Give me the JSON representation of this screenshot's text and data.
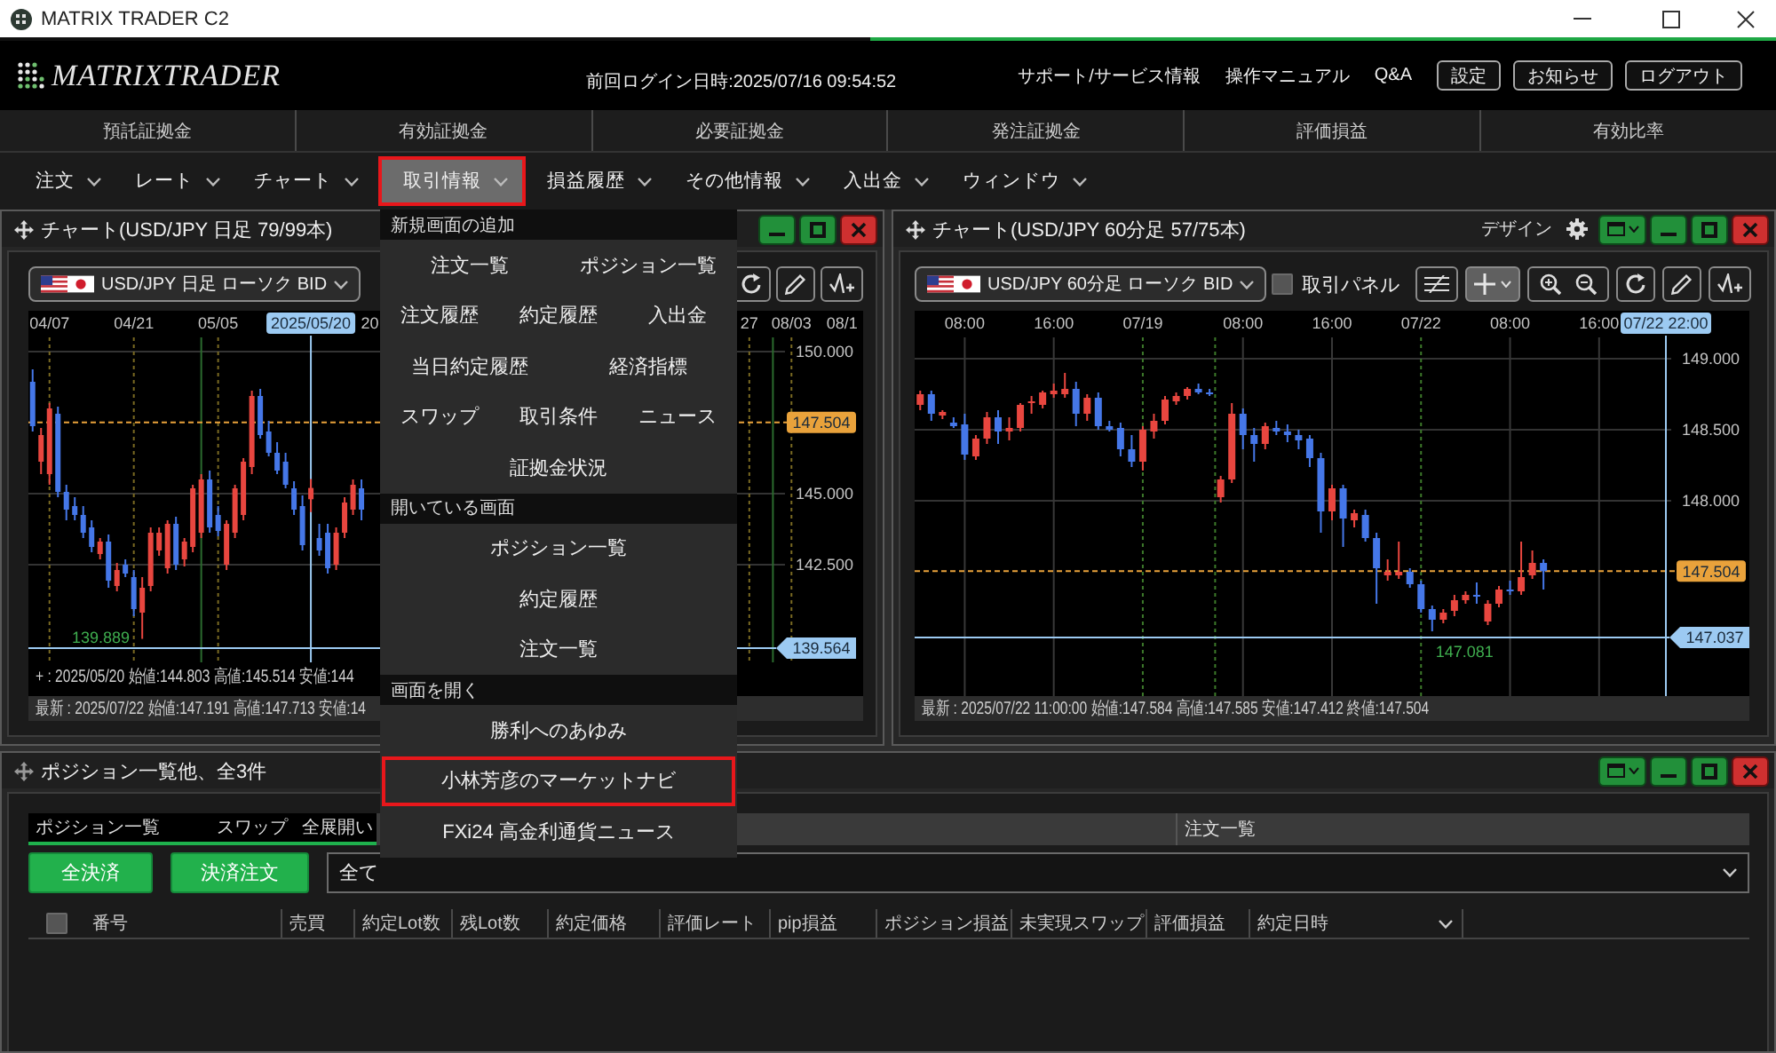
{
  "window": {
    "title": "MATRIX TRADER C2"
  },
  "header": {
    "logo": "MATRIXTRADER",
    "last_login": "前回ログイン日時:2025/07/16 09:54:52",
    "links": [
      "サポート/サービス情報",
      "操作マニュアル",
      "Q&A"
    ],
    "buttons": [
      "設定",
      "お知らせ",
      "ログアウト"
    ]
  },
  "summary": [
    "預託証拠金",
    "有効証拠金",
    "必要証拠金",
    "発注証拠金",
    "評価損益",
    "有効比率"
  ],
  "menu": [
    {
      "label": "注文",
      "selected": false,
      "highlighted": false
    },
    {
      "label": "レート",
      "selected": false,
      "highlighted": false
    },
    {
      "label": "チャート",
      "selected": false,
      "highlighted": false
    },
    {
      "label": "取引情報",
      "selected": true,
      "highlighted": true
    },
    {
      "label": "損益履歴",
      "selected": false,
      "highlighted": false
    },
    {
      "label": "その他情報",
      "selected": false,
      "highlighted": false
    },
    {
      "label": "入出金",
      "selected": false,
      "highlighted": false
    },
    {
      "label": "ウィンドウ",
      "selected": false,
      "highlighted": false
    }
  ],
  "dropdown": {
    "sections": [
      {
        "title": "新規画面の追加",
        "rows": [
          {
            "items": [
              {
                "label": "注文一覧",
                "highlighted": false
              },
              {
                "label": "ポジション一覧",
                "highlighted": false
              }
            ]
          },
          {
            "items": [
              {
                "label": "注文履歴",
                "highlighted": false
              },
              {
                "label": "約定履歴",
                "highlighted": false
              },
              {
                "label": "入出金",
                "highlighted": false
              }
            ]
          },
          {
            "items": [
              {
                "label": "当日約定履歴",
                "highlighted": false
              },
              {
                "label": "経済指標",
                "highlighted": false
              }
            ]
          },
          {
            "items": [
              {
                "label": "スワップ",
                "highlighted": false
              },
              {
                "label": "取引条件",
                "highlighted": false
              },
              {
                "label": "ニュース",
                "highlighted": false
              }
            ]
          },
          {
            "items": [
              {
                "label": "証拠金状況",
                "highlighted": false
              }
            ]
          }
        ]
      },
      {
        "title": "開いている画面",
        "rows": [
          {
            "items": [
              {
                "label": "ポジション一覧",
                "highlighted": false
              }
            ]
          },
          {
            "items": [
              {
                "label": "約定履歴",
                "highlighted": false
              }
            ]
          },
          {
            "items": [
              {
                "label": "注文一覧",
                "highlighted": false
              }
            ]
          }
        ]
      },
      {
        "title": "画面を開く",
        "rows": [
          {
            "items": [
              {
                "label": "勝利へのあゆみ",
                "highlighted": false
              }
            ]
          },
          {
            "items": [
              {
                "label": "小林芳彦のマーケットナビ",
                "highlighted": true
              }
            ]
          },
          {
            "items": [
              {
                "label": "FXi24 高金利通貨ニュース",
                "highlighted": false
              }
            ]
          }
        ]
      }
    ]
  },
  "charts": [
    {
      "title": "チャート(USD/JPY 日足 79/99本)",
      "window_controls": [
        {
          "kind": "minimize"
        },
        {
          "kind": "maximize"
        },
        {
          "kind": "close"
        }
      ],
      "symbol": "USD/JPY 日足 ローソク BID",
      "tools": [
        {
          "kind": "refresh",
          "selected": false
        },
        {
          "kind": "pencil",
          "selected": false
        },
        {
          "kind": "wave",
          "selected": false
        }
      ],
      "chart_data": {
        "type": "candlestick",
        "categories": [
          null,
          null,
          "04/07",
          null,
          null,
          null,
          null,
          null,
          null,
          null,
          null,
          null,
          "04/21",
          null,
          null,
          null,
          null,
          null,
          null,
          null,
          null,
          null,
          "05/05",
          null,
          null,
          null,
          null,
          null,
          null,
          null,
          null,
          null,
          null,
          "2025/05/20",
          null,
          null,
          null,
          null,
          null,
          null,
          "20",
          null,
          null,
          null,
          null,
          null,
          null,
          null,
          null,
          null,
          null,
          null,
          null,
          null,
          null,
          null,
          null,
          null,
          null,
          null,
          null,
          null,
          null,
          null,
          null,
          null,
          null,
          null,
          null,
          null,
          null,
          null,
          null,
          null,
          null,
          null,
          null,
          null,
          null,
          null,
          null,
          null,
          null,
          null,
          null,
          "27",
          null,
          null,
          null,
          null,
          "08/03",
          null,
          null,
          null,
          null,
          null,
          "08/1",
          null,
          null
        ],
        "ohlc": [
          [
            148.9375,
            149.375,
            147.1875,
            147.375
          ],
          [
            146.125,
            147.3125,
            145.6875,
            147.0625
          ],
          [
            145.6875,
            148.1875,
            145.3125,
            148.0
          ],
          [
            147.8125,
            148.0625,
            144.875,
            145.0625
          ],
          [
            145.0625,
            145.3125,
            144.0625,
            144.4375
          ],
          [
            144.5625,
            144.875,
            144.0625,
            144.25
          ],
          [
            144.25,
            144.5625,
            143.4375,
            143.625
          ],
          [
            143.8125,
            144.0625,
            142.9375,
            143.125
          ],
          [
            142.875,
            143.4375,
            142.6875,
            143.3125
          ],
          [
            143.3125,
            143.5625,
            141.6875,
            141.9375
          ],
          [
            141.75,
            142.5625,
            141.5625,
            142.3125
          ],
          [
            142.5,
            142.6875,
            142.0625,
            142.1875
          ],
          [
            142.0625,
            142.3125,
            140.6875,
            140.9375
          ],
          [
            140.8125,
            142.0625,
            139.889,
            141.6875
          ],
          [
            141.75,
            143.8125,
            141.5625,
            143.625
          ],
          [
            143.0,
            143.8125,
            142.8125,
            143.625
          ],
          [
            142.375,
            144.0625,
            142.1875,
            143.9375
          ],
          [
            143.9375,
            144.1875,
            142.3125,
            142.5
          ],
          [
            142.6875,
            143.4375,
            142.4375,
            143.3125
          ],
          [
            143.125,
            145.3125,
            142.9375,
            145.1875
          ],
          [
            143.625,
            145.6875,
            143.4375,
            145.5
          ],
          [
            145.5,
            145.8125,
            143.625,
            143.8125
          ],
          [
            144.25,
            144.5625,
            143.5,
            143.6875
          ],
          [
            142.5,
            144.0625,
            142.3125,
            143.9375
          ],
          [
            143.625,
            145.3125,
            143.4375,
            145.1875
          ],
          [
            144.25,
            146.25,
            144.0625,
            146.125
          ],
          [
            145.9375,
            148.625,
            145.6875,
            148.4375
          ],
          [
            148.4375,
            148.6875,
            146.9375,
            147.0625
          ],
          [
            147.1875,
            147.5625,
            146.3125,
            146.4375
          ],
          [
            146.4375,
            146.8125,
            145.6875,
            145.8125
          ],
          [
            146.125,
            146.4375,
            145.1875,
            145.3125
          ],
          [
            145.1875,
            145.4375,
            144.25,
            144.4375
          ],
          [
            144.5625,
            144.9375,
            143.0,
            143.1875
          ],
          [
            144.803,
            145.514,
            144.35,
            145.2
          ],
          [
            143.4375,
            143.9375,
            142.8125,
            143.0
          ],
          [
            143.625,
            143.9375,
            142.1875,
            142.375
          ],
          [
            142.5,
            143.8125,
            142.3125,
            143.625
          ],
          [
            143.625,
            144.875,
            143.4375,
            144.6875
          ],
          [
            144.4375,
            145.5,
            144.25,
            145.3125
          ],
          [
            145.1875,
            145.5,
            144.0625,
            144.4375
          ],
          null,
          null,
          null,
          null,
          null,
          null,
          null,
          null,
          null,
          null,
          null,
          null,
          null,
          null,
          null,
          null,
          null,
          null,
          null,
          null,
          null,
          null,
          null,
          null,
          null,
          null,
          null,
          null,
          null,
          null,
          null,
          null,
          null,
          null,
          null,
          null,
          null,
          null,
          null,
          null,
          null,
          null,
          null,
          null,
          null,
          null,
          null,
          null,
          null,
          null,
          null,
          null,
          null,
          null,
          null,
          null,
          null,
          null,
          null
        ],
        "ylim": [
          137.875,
          151.4375
        ],
        "yticks": [
          {
            "value": 150,
            "label": "150.000"
          },
          {
            "value": 145,
            "label": "145.000"
          },
          {
            "value": 142.5,
            "label": "142.500"
          }
        ],
        "grid": true,
        "ref_lines": [
          {
            "axis": "y",
            "value": 147.504,
            "label": "147.504",
            "color": "#e9a23b"
          },
          {
            "axis": "y",
            "value": 139.564,
            "label": "139.564",
            "color": "#9ccaf2"
          },
          {
            "axis": "x",
            "value": "2025/05/20",
            "color": "#9ccaf2"
          }
        ],
        "annotations": [
          "139.889"
        ]
      },
      "cursor_info": "+ : 2025/05/20 始値:144.803 高値:145.514 安値:144",
      "status": "最新 : 2025/07/22 始値:147.191 高値:147.713 安値:14"
    },
    {
      "title": "チャート(USD/JPY 60分足 57/75本)",
      "design_label": "デザイン",
      "window_controls": [
        {
          "kind": "layout"
        },
        {
          "kind": "minimize"
        },
        {
          "kind": "maximize"
        },
        {
          "kind": "close"
        }
      ],
      "symbol": "USD/JPY 60分足 ローソク BID",
      "trade_panel": {
        "label": "取引パネル",
        "checked": false
      },
      "tools": [
        {
          "kind": "indicator",
          "selected": false
        },
        {
          "kind": "crosshair",
          "selected": true
        },
        {
          "kind": "zoom",
          "selected": false
        },
        {
          "kind": "refresh",
          "selected": false
        },
        {
          "kind": "pencil",
          "selected": false
        },
        {
          "kind": "wave",
          "selected": false
        }
      ],
      "chart_data": {
        "type": "candlestick",
        "categories": [
          null,
          null,
          null,
          null,
          "08:00",
          null,
          null,
          null,
          null,
          null,
          null,
          null,
          "16:00",
          null,
          null,
          null,
          null,
          null,
          null,
          null,
          "07/19",
          null,
          null,
          null,
          null,
          null,
          null,
          null,
          null,
          "08:00",
          null,
          null,
          null,
          null,
          null,
          null,
          null,
          "16:00",
          null,
          null,
          null,
          null,
          null,
          null,
          null,
          "07/22",
          null,
          null,
          null,
          null,
          null,
          null,
          null,
          "08:00",
          null,
          null,
          null,
          null,
          null,
          null,
          null,
          "16:00",
          null,
          null,
          null,
          null,
          null,
          "07/22 22:00",
          null,
          null,
          null,
          null,
          null,
          null,
          null
        ],
        "ohlc": [
          [
            148.675,
            148.775,
            148.6375,
            148.75
          ],
          [
            148.75,
            148.775,
            148.5625,
            148.6125
          ],
          [
            148.6,
            148.6375,
            148.575,
            148.625
          ],
          [
            148.55,
            148.5875,
            148.5125,
            148.525
          ],
          [
            148.5375,
            148.6125,
            148.2875,
            148.325
          ],
          [
            148.3125,
            148.4625,
            148.2875,
            148.4375
          ],
          [
            148.4375,
            148.625,
            148.4,
            148.5875
          ],
          [
            148.5875,
            148.6375,
            148.4,
            148.4875
          ],
          [
            148.4875,
            148.5875,
            148.425,
            148.5125
          ],
          [
            148.5125,
            148.6875,
            148.4875,
            148.675
          ],
          [
            148.6875,
            148.7375,
            148.6125,
            148.7
          ],
          [
            148.675,
            148.775,
            148.65,
            148.7625
          ],
          [
            148.75,
            148.825,
            148.725,
            148.775
          ],
          [
            148.75,
            148.9,
            148.725,
            148.7875
          ],
          [
            148.7875,
            148.8375,
            148.525,
            148.6125
          ],
          [
            148.6125,
            148.75,
            148.5625,
            148.725
          ],
          [
            148.725,
            148.7625,
            148.5,
            148.525
          ],
          [
            148.525,
            148.5625,
            148.4875,
            148.5
          ],
          [
            148.5125,
            148.55,
            148.3125,
            148.3625
          ],
          [
            148.3625,
            148.4625,
            148.2375,
            148.275
          ],
          [
            148.275,
            148.525,
            148.2125,
            148.5
          ],
          [
            148.4875,
            148.6125,
            148.4375,
            148.5625
          ],
          [
            148.5625,
            148.7375,
            148.5375,
            148.7125
          ],
          [
            148.7,
            148.7625,
            148.675,
            148.7375
          ],
          [
            148.7375,
            148.8,
            148.7125,
            148.7875
          ],
          [
            148.7875,
            148.825,
            148.75,
            148.7625
          ],
          [
            148.7625,
            148.7875,
            148.7375,
            148.75
          ],
          [
            148.025,
            148.175,
            147.9875,
            148.15
          ],
          [
            148.15,
            148.6875,
            148.125,
            148.6125
          ],
          [
            148.6125,
            148.65,
            148.3625,
            148.4625
          ],
          [
            148.4625,
            148.5125,
            148.275,
            148.4
          ],
          [
            148.4,
            148.55,
            148.3625,
            148.525
          ],
          [
            148.5125,
            148.5625,
            148.4625,
            148.4875
          ],
          [
            148.4875,
            148.5375,
            148.4125,
            148.4625
          ],
          [
            148.4625,
            148.5,
            148.3625,
            148.425
          ],
          [
            148.4375,
            148.4625,
            148.2375,
            148.3
          ],
          [
            148.3,
            148.3375,
            147.775,
            147.925
          ],
          [
            147.925,
            148.1125,
            147.8625,
            148.0875
          ],
          [
            148.0875,
            148.1125,
            147.675,
            147.875
          ],
          [
            147.8625,
            147.9375,
            147.8125,
            147.9125
          ],
          [
            147.9,
            147.9375,
            147.7125,
            147.7375
          ],
          [
            147.7375,
            147.775,
            147.275,
            147.525
          ],
          [
            147.475,
            147.5875,
            147.4375,
            147.5
          ],
          [
            147.475,
            147.7125,
            147.45,
            147.5
          ],
          [
            147.5,
            147.525,
            147.3875,
            147.4125
          ],
          [
            147.4125,
            147.4375,
            147.2125,
            147.2375
          ],
          [
            147.2375,
            147.2625,
            147.081,
            147.1625
          ],
          [
            147.1625,
            147.2375,
            147.1375,
            147.2125
          ],
          [
            147.225,
            147.3375,
            147.1875,
            147.3
          ],
          [
            147.3,
            147.3625,
            147.275,
            147.3375
          ],
          [
            147.3375,
            147.425,
            147.275,
            147.325
          ],
          [
            147.15,
            147.3,
            147.125,
            147.275
          ],
          [
            147.275,
            147.4,
            147.25,
            147.375
          ],
          [
            147.375,
            147.4375,
            147.3375,
            147.3625
          ],
          [
            147.3625,
            147.7125,
            147.3375,
            147.4625
          ],
          [
            147.475,
            147.65,
            147.45,
            147.5625
          ],
          [
            147.5625,
            147.5875,
            147.375,
            147.504
          ],
          null,
          null,
          null,
          null,
          null,
          null,
          null,
          null,
          null,
          null,
          null,
          null,
          null,
          null,
          null,
          null,
          null,
          null
        ],
        "ylim": [
          146.625,
          149.3375
        ],
        "yticks": [
          {
            "value": 149,
            "label": "149.000"
          },
          {
            "value": 148.5,
            "label": "148.500"
          },
          {
            "value": 148,
            "label": "148.000"
          }
        ],
        "grid": true,
        "ref_lines": [
          {
            "axis": "y",
            "value": 147.504,
            "label": "147.504",
            "color": "#e9a23b"
          },
          {
            "axis": "y",
            "value": 147.037,
            "label": "147.037",
            "color": "#9ccaf2"
          },
          {
            "axis": "x",
            "value": "07/22 22:00",
            "color": "#9ccaf2"
          }
        ],
        "annotations": [
          {
            "y": 147.081,
            "text": "147.081"
          }
        ]
      },
      "status": "最新 : 2025/07/22 11:00:00 始値:147.584 高値:147.585 安値:147.412 終値:147.504"
    }
  ],
  "positions": {
    "title": "ポジション一覧他、全3件",
    "window_controls": [
      {
        "kind": "layout"
      },
      {
        "kind": "minimize"
      },
      {
        "kind": "maximize"
      },
      {
        "kind": "close"
      }
    ],
    "panes": [
      {
        "label": "ポジション一覧",
        "selected": true,
        "actions": [
          "スワップ",
          "全展開い"
        ]
      },
      {
        "label": "注文一覧",
        "selected": false
      }
    ],
    "buttons": [
      "全決済",
      "決済注文"
    ],
    "filter": {
      "value": "全て"
    },
    "select_all": {
      "checked": false
    },
    "columns": [
      "番号",
      "売買",
      "約定Lot数",
      "残Lot数",
      "約定価格",
      "評価レート",
      "pip損益",
      "ポジション損益",
      "未実現スワップ",
      "評価損益",
      "約定日時"
    ]
  }
}
